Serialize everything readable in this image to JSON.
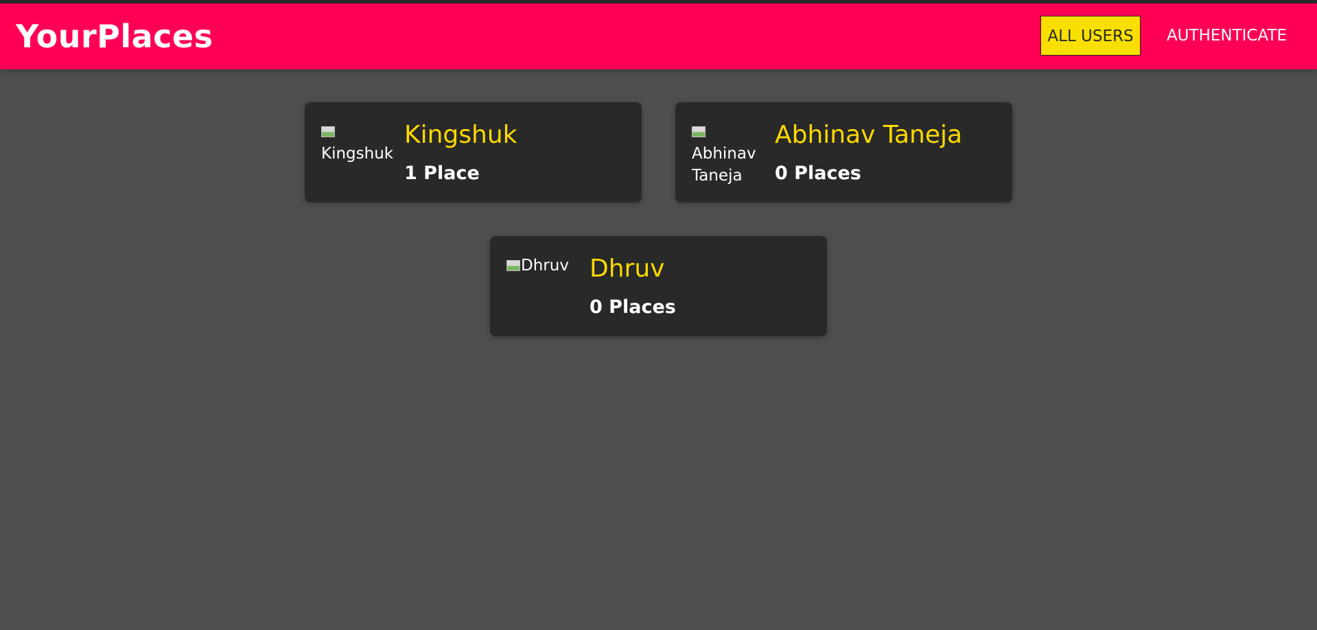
{
  "header": {
    "logo": "YourPlaces",
    "nav": [
      {
        "label": "ALL USERS",
        "active": true
      },
      {
        "label": "AUTHENTICATE",
        "active": false
      }
    ]
  },
  "users": [
    {
      "image_alt": "Kingshuk",
      "name": "Kingshuk",
      "places": "1 Place"
    },
    {
      "image_alt": "Abhinav Taneja",
      "name": "Abhinav Taneja",
      "places": "0 Places"
    },
    {
      "image_alt": "Dhruv",
      "name": "Dhruv",
      "places": "0 Places"
    }
  ],
  "colors": {
    "header_bg": "#ff0055",
    "page_bg": "#4e4e4e",
    "card_bg": "#292929",
    "accent_yellow": "#ffd900",
    "active_nav_bg": "#f8df00"
  }
}
